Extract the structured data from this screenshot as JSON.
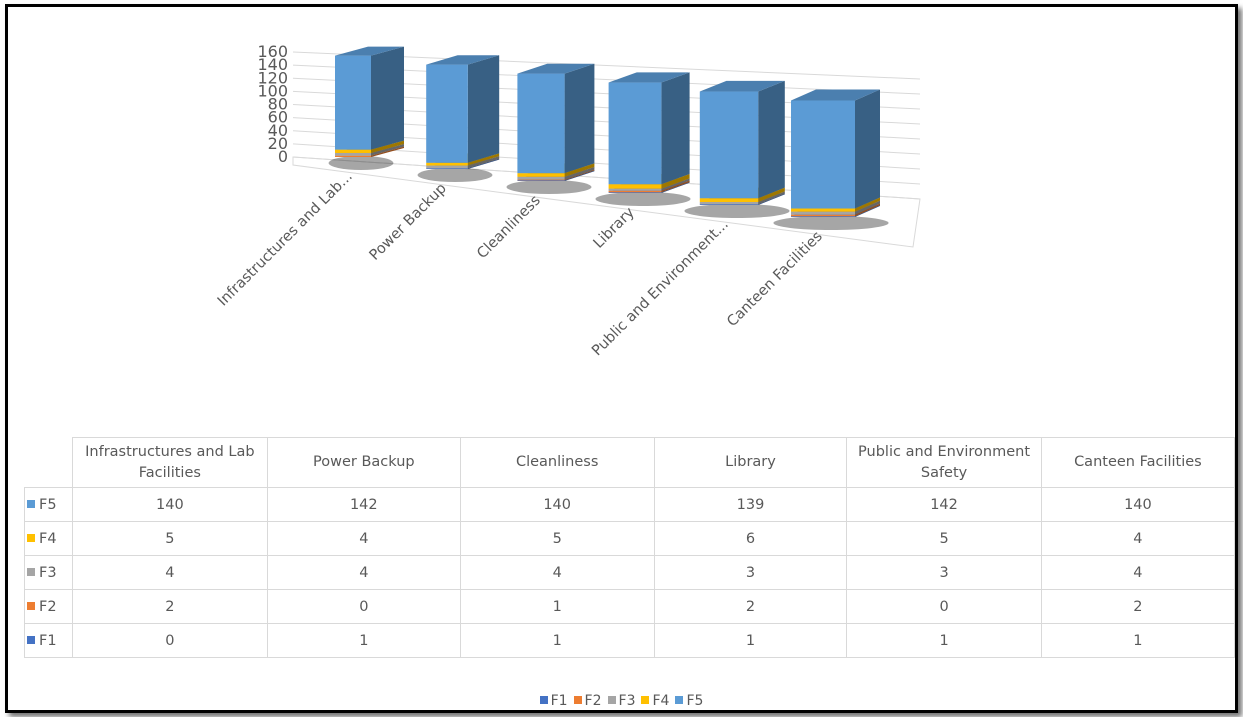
{
  "chart_data": {
    "type": "bar",
    "subtype": "3d-stacked-column",
    "categories": [
      "Infrastructures and Lab Facilities",
      "Power Backup",
      "Cleanliness",
      "Library",
      "Public and Environment Safety",
      "Canteen Facilities"
    ],
    "axis_category_labels": [
      "Infrastructures and Lab...",
      "Power Backup",
      "Cleanliness",
      "Library",
      "Public and Environment...",
      "Canteen Facilities"
    ],
    "series": [
      {
        "name": "F1",
        "values": [
          0,
          1,
          1,
          1,
          1,
          1
        ],
        "color": "#4472c4"
      },
      {
        "name": "F2",
        "values": [
          2,
          0,
          1,
          2,
          0,
          2
        ],
        "color": "#ed7d31"
      },
      {
        "name": "F3",
        "values": [
          4,
          4,
          4,
          3,
          3,
          4
        ],
        "color": "#a5a5a5"
      },
      {
        "name": "F4",
        "values": [
          5,
          4,
          5,
          6,
          5,
          4
        ],
        "color": "#ffc000"
      },
      {
        "name": "F5",
        "values": [
          140,
          142,
          140,
          139,
          142,
          140
        ],
        "color": "#5b9bd5"
      }
    ],
    "yticks": [
      0,
      20,
      40,
      60,
      80,
      100,
      120,
      140,
      160
    ],
    "ylim": [
      0,
      160
    ],
    "title": "",
    "xlabel": "",
    "ylabel": "",
    "grid": true,
    "legend": "bottom",
    "data_table": true,
    "table_row_order": [
      "F5",
      "F4",
      "F3",
      "F2",
      "F1"
    ]
  }
}
